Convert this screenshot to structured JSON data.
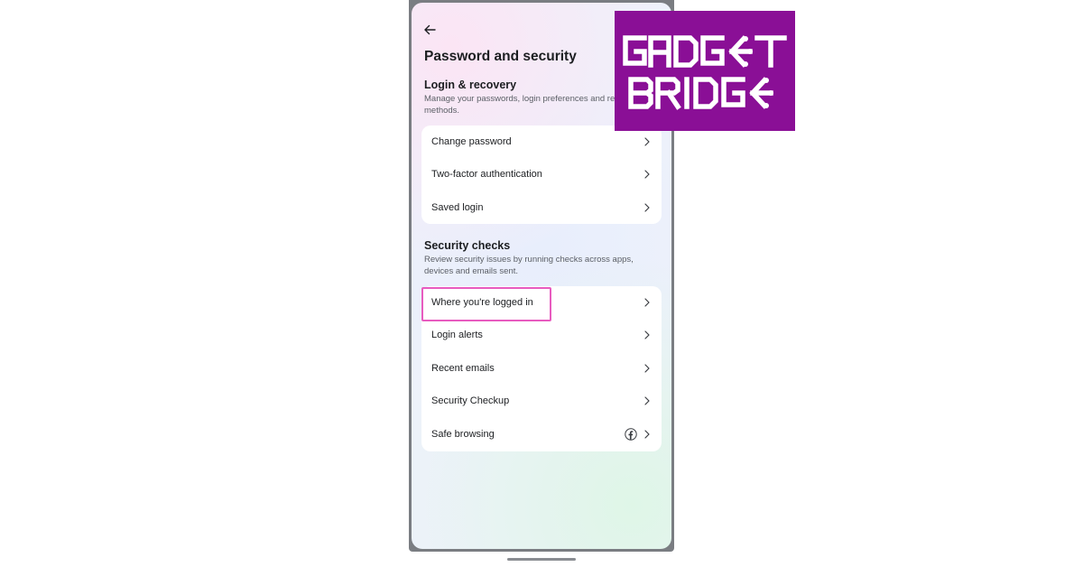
{
  "header": {
    "title": "Password and security"
  },
  "login_recovery": {
    "title": "Login & recovery",
    "description": "Manage your passwords, login preferences and recovery methods.",
    "items": [
      {
        "label": "Change password"
      },
      {
        "label": "Two-factor authentication"
      },
      {
        "label": "Saved login"
      }
    ]
  },
  "security_checks": {
    "title": "Security checks",
    "description": "Review security issues by running checks across apps, devices and emails sent.",
    "items": [
      {
        "label": "Where you're logged in"
      },
      {
        "label": "Login alerts"
      },
      {
        "label": "Recent emails"
      },
      {
        "label": "Security Checkup"
      },
      {
        "label": "Safe browsing"
      }
    ]
  },
  "logo": {
    "line1": "GADGET",
    "line2": "BRIDGE",
    "background": "#8a0f96",
    "foreground": "#ffffff"
  },
  "colors": {
    "highlight": "#e85bbf",
    "text_primary": "#1c1e21",
    "text_secondary": "#5b5f66"
  },
  "icons": {
    "back": "arrow-left-icon",
    "chevron": "chevron-right-icon",
    "facebook": "facebook-icon"
  }
}
